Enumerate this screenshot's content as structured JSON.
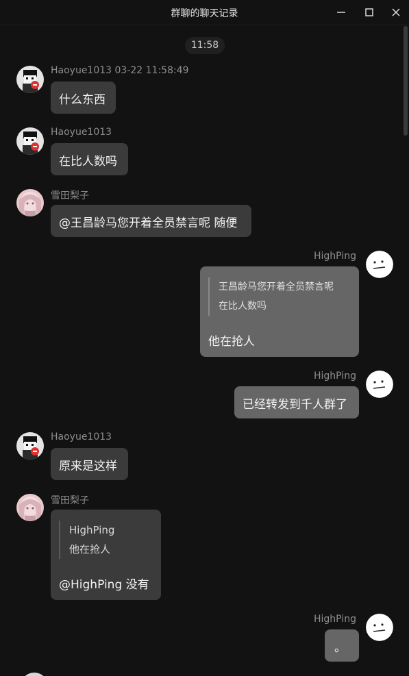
{
  "window": {
    "title": "群聊的聊天记录",
    "minimize_icon": "minimize-icon",
    "maximize_icon": "maximize-icon",
    "close_icon": "close-icon"
  },
  "time_divider": "11:58",
  "messages": [
    {
      "sender": "Haoyue1013",
      "timestamp": "03-22 11:58:49",
      "header": "Haoyue1013 03-22 11:58:49",
      "text": "什么东西",
      "avatar": "pixel-character-avatar"
    },
    {
      "sender": "Haoyue1013",
      "header": "Haoyue1013",
      "text": "在比人数吗",
      "avatar": "pixel-character-avatar"
    },
    {
      "sender": "雪田梨子",
      "header": "雪田梨子",
      "text": "@王昌龄马您开着全员禁言呢 随便",
      "avatar": "anime-girl-avatar"
    },
    {
      "sender": "HighPing",
      "header": "HighPing",
      "quote_lines": [
        "王昌龄马您开着全员禁言呢",
        "在比人数吗"
      ],
      "text": "他在抢人",
      "avatar": "face-sketch-avatar"
    },
    {
      "sender": "HighPing",
      "header": "HighPing",
      "text": "已经转发到千人群了",
      "avatar": "face-sketch-avatar"
    },
    {
      "sender": "Haoyue1013",
      "header": "Haoyue1013",
      "text": "原来是这样",
      "avatar": "pixel-character-avatar"
    },
    {
      "sender": "雪田梨子",
      "header": "雪田梨子",
      "quote_lines": [
        "HighPing",
        "他在抢人"
      ],
      "text": "@HighPing 没有",
      "avatar": "anime-girl-avatar"
    },
    {
      "sender": "HighPing",
      "header": "HighPing",
      "text": "。",
      "avatar": "face-sketch-avatar"
    }
  ],
  "colors": {
    "background": "#121212",
    "bubble_other": "#3b3b3b",
    "bubble_self": "#666666",
    "sender_text": "#8e8e8e",
    "message_text": "#f2f2f2"
  }
}
